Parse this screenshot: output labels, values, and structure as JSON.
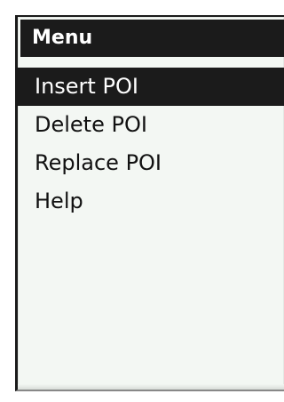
{
  "menu": {
    "title": "Menu",
    "items": [
      {
        "label": "Insert POI",
        "selected": true
      },
      {
        "label": "Delete POI",
        "selected": false
      },
      {
        "label": "Replace POI",
        "selected": false
      },
      {
        "label": "Help",
        "selected": false
      }
    ]
  },
  "colors": {
    "header_bg": "#1b1b1b",
    "selected_bg": "#1b1b1b",
    "panel_bg": "#f3f7f3",
    "text": "#111111"
  }
}
